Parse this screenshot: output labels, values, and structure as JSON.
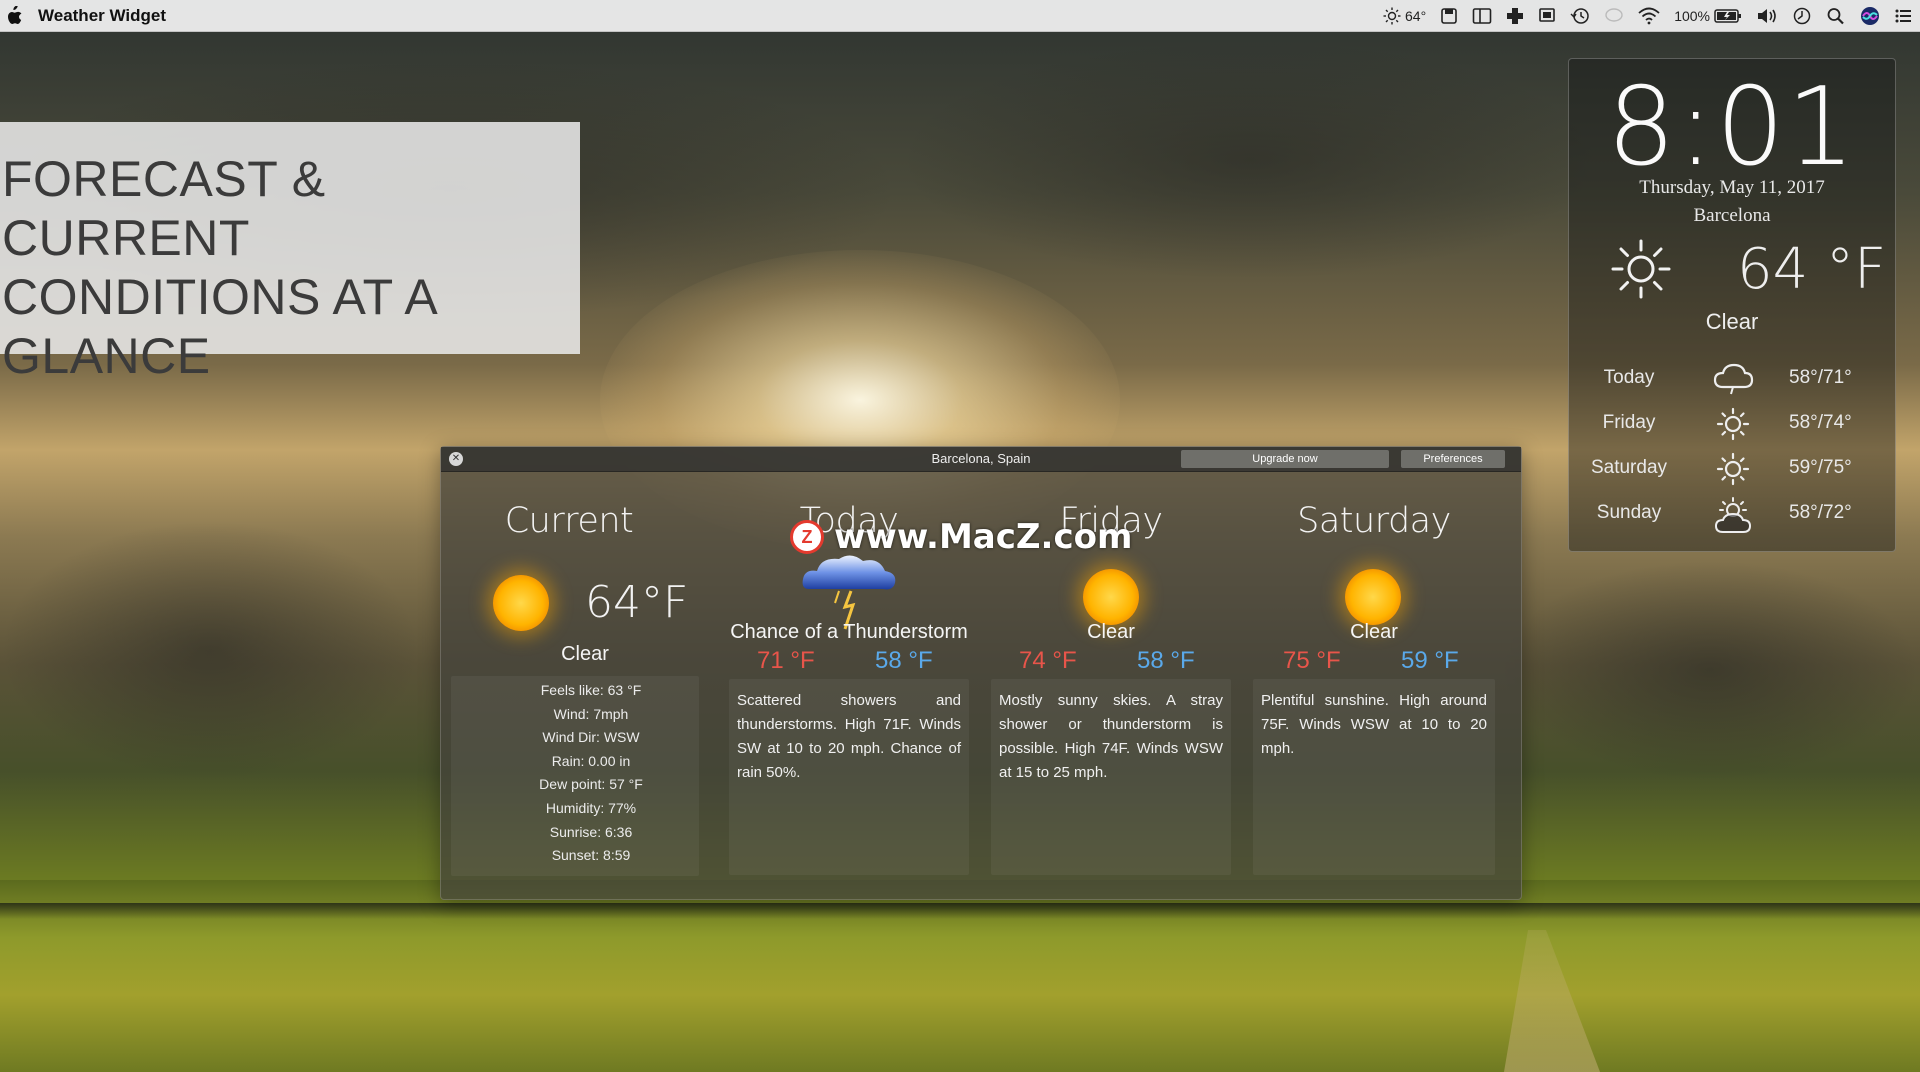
{
  "menubar": {
    "app_name": "Weather Widget",
    "weather_temp": "64°",
    "battery": "100%"
  },
  "banner": {
    "lines": [
      "FORECAST & CURRENT",
      "CONDITIONS AT A",
      "GLANCE"
    ]
  },
  "clock_widget": {
    "time": "8:01",
    "date": "Thursday, May 11, 2017",
    "city": "Barcelona",
    "temperature": "64 °F",
    "condition": "Clear",
    "forecast": [
      {
        "day": "Today",
        "icon": "cloud-icon",
        "range": "58°/71°"
      },
      {
        "day": "Friday",
        "icon": "sun-icon",
        "range": "58°/74°"
      },
      {
        "day": "Saturday",
        "icon": "sun-icon",
        "range": "59°/75°"
      },
      {
        "day": "Sunday",
        "icon": "partly-cloudy-icon",
        "range": "58°/72°"
      }
    ]
  },
  "window": {
    "title": "Barcelona, Spain",
    "upgrade_label": "Upgrade now",
    "preferences_label": "Preferences",
    "current": {
      "heading": "Current",
      "temperature": "64°F",
      "condition": "Clear",
      "details": [
        "Feels like: 63 °F",
        "Wind: 7mph",
        "Wind Dir: WSW",
        "Rain: 0.00 in",
        "Dew point: 57 °F",
        "Humidity: 77%",
        "Sunrise: 6:36",
        "Sunset: 8:59"
      ]
    },
    "days": [
      {
        "heading": "Today",
        "icon": "thunderstorm-icon",
        "condition": "Chance of a Thunderstorm",
        "high": "71 °F",
        "low": "58 °F",
        "description": "Scattered showers and thunderstorms. High 71F. Winds SW at 10 to 20 mph. Chance of rain 50%."
      },
      {
        "heading": "Friday",
        "icon": "sun-icon",
        "condition": "Clear",
        "high": "74 °F",
        "low": "58 °F",
        "description": "Mostly sunny skies. A stray shower or thunderstorm is possible. High 74F. Winds WSW at 15 to 25 mph."
      },
      {
        "heading": "Saturday",
        "icon": "sun-icon",
        "condition": "Clear",
        "high": "75 °F",
        "low": "59 °F",
        "description": "Plentiful sunshine. High around 75F. Winds WSW at 10 to 20 mph."
      }
    ]
  },
  "watermark": {
    "text": "www.MacZ.com",
    "logo_letter": "Z"
  },
  "colors": {
    "high_temp": "#e8554a",
    "low_temp": "#5aa9ea"
  }
}
